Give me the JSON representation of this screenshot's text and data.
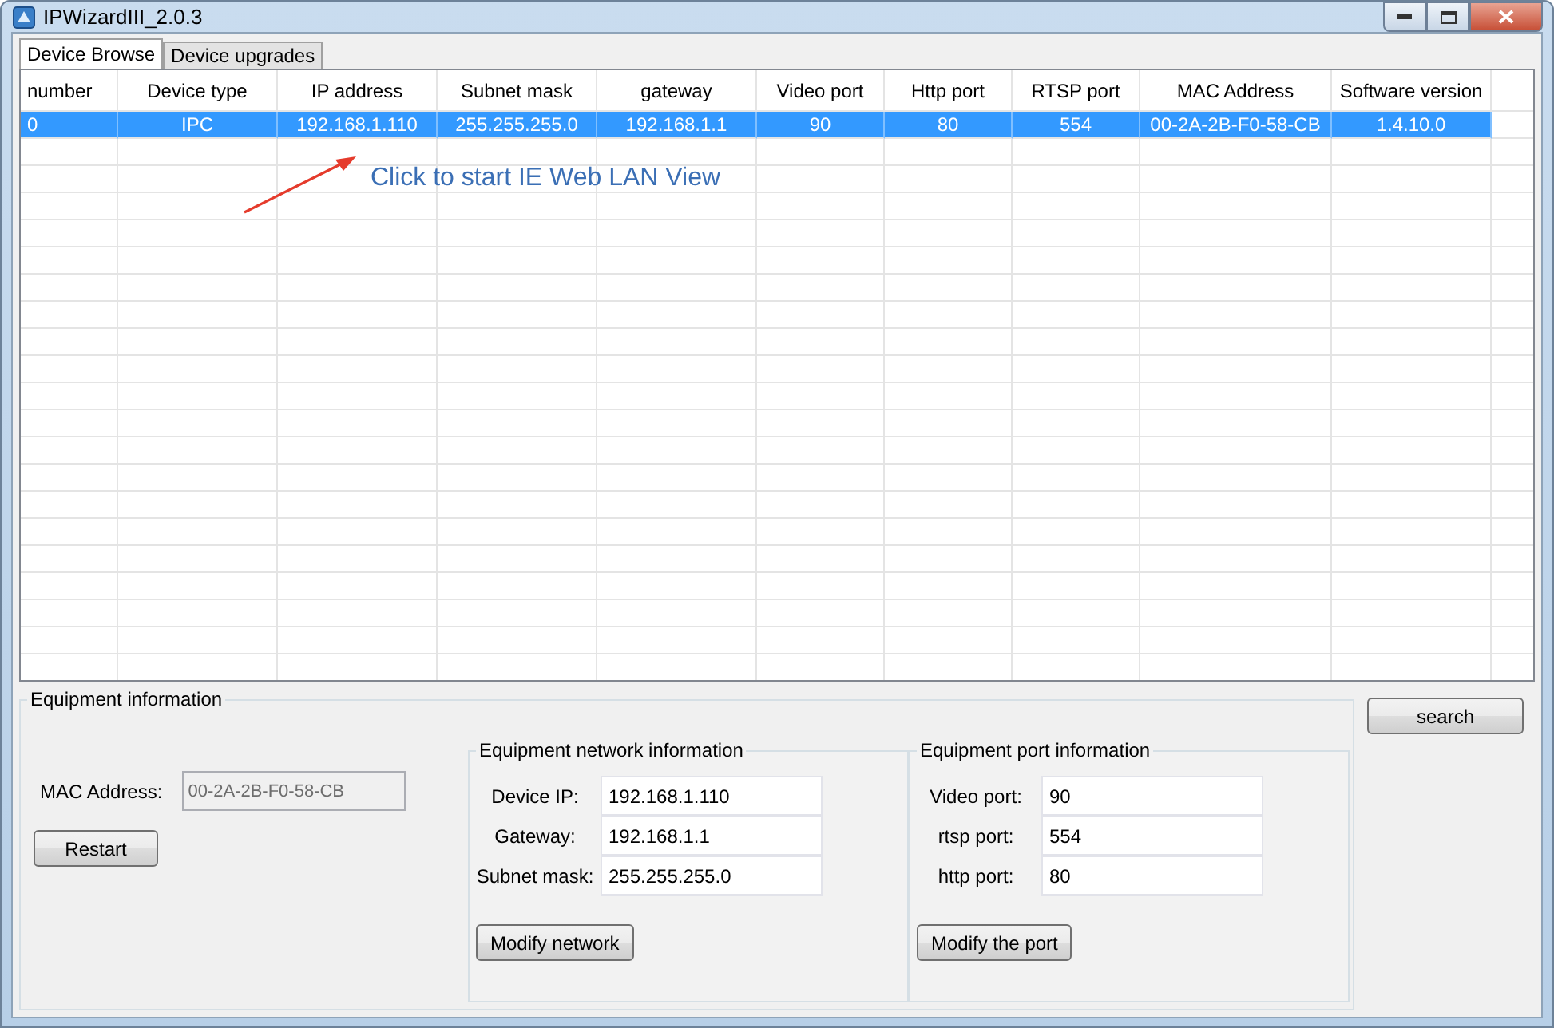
{
  "window": {
    "title": "IPWizardIII_2.0.3"
  },
  "tabs": [
    {
      "label": "Device Browse",
      "selected": true
    },
    {
      "label": "Device upgrades",
      "selected": false
    }
  ],
  "table": {
    "columns": [
      "number",
      "Device type",
      "IP address",
      "Subnet mask",
      "gateway",
      "Video port",
      "Http port",
      "RTSP port",
      "MAC Address",
      "Software version"
    ],
    "rows": [
      {
        "selected": true,
        "cells": [
          "0",
          "IPC",
          "192.168.1.110",
          "255.255.255.0",
          "192.168.1.1",
          "90",
          "80",
          "554",
          "00-2A-2B-F0-58-CB",
          "1.4.10.0"
        ]
      }
    ]
  },
  "annotation": {
    "text": "Click to start IE Web LAN View"
  },
  "equipment_info": {
    "title": "Equipment information",
    "mac_label": "MAC Address:",
    "mac_value": "00-2A-2B-F0-58-CB",
    "mac_disabled": true,
    "restart_button": "Restart",
    "network": {
      "title": "Equipment network information",
      "fields": [
        {
          "label": "Device IP:",
          "value": "192.168.1.110"
        },
        {
          "label": "Gateway:",
          "value": "192.168.1.1"
        },
        {
          "label": "Subnet mask:",
          "value": "255.255.255.0"
        }
      ],
      "button": "Modify network"
    },
    "ports": {
      "title": "Equipment port information",
      "fields": [
        {
          "label": "Video port:",
          "value": "90"
        },
        {
          "label": "rtsp port:",
          "value": "554"
        },
        {
          "label": "http port:",
          "value": "80"
        }
      ],
      "button": "Modify the port"
    }
  },
  "search_button": "search"
}
